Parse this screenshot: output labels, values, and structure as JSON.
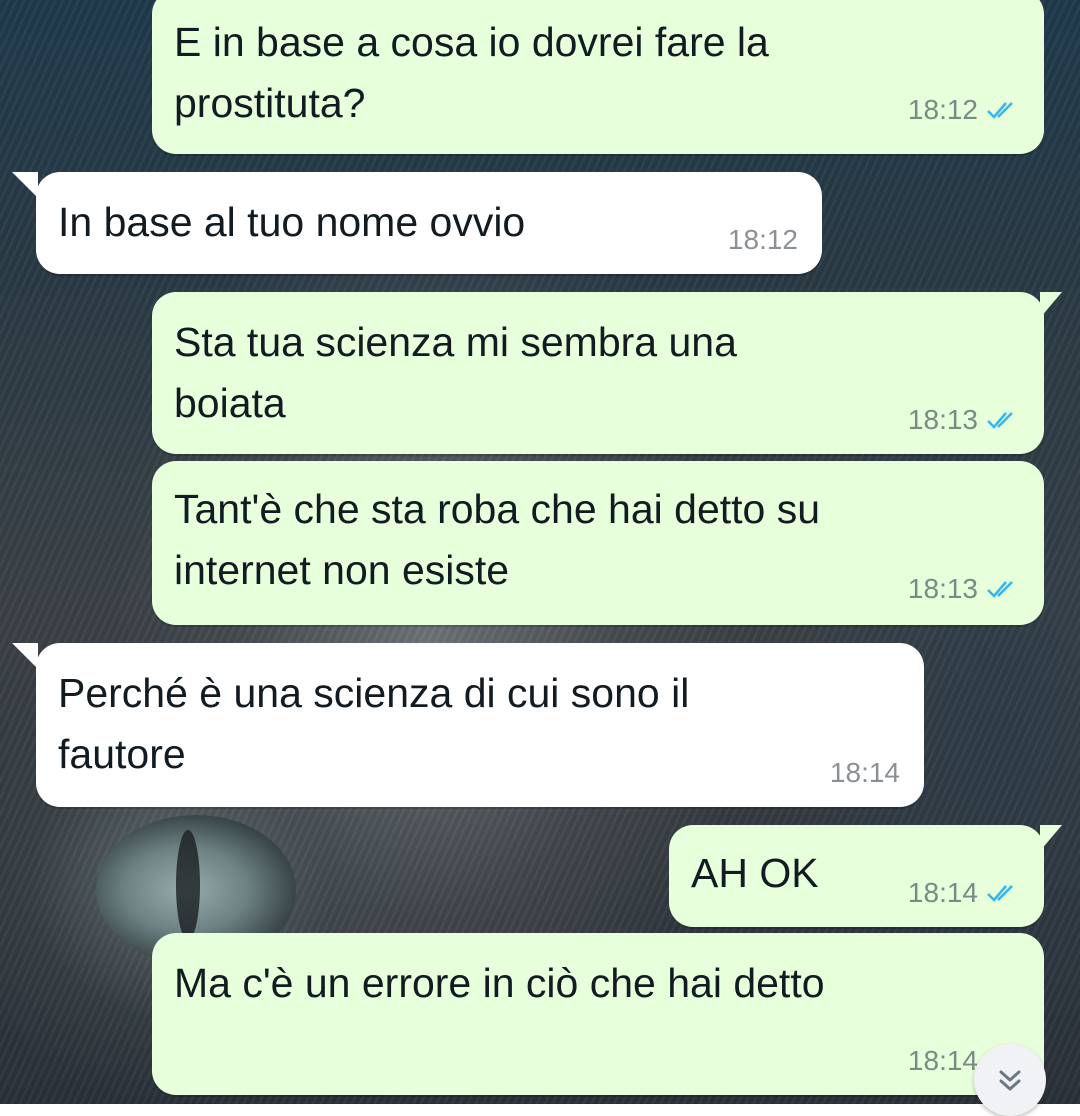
{
  "wallpaper": {
    "description_icon": "cat-wallpaper"
  },
  "messages": [
    {
      "direction": "out",
      "lines": [
        "E in base a cosa io dovrei fare la",
        "prostituta?"
      ],
      "time": "18:12",
      "status": "read"
    },
    {
      "direction": "in",
      "lines": [
        "In base al tuo nome ovvio"
      ],
      "time": "18:12"
    },
    {
      "direction": "out",
      "lines": [
        "Sta tua scienza mi sembra una",
        "boiata"
      ],
      "time": "18:13",
      "status": "read"
    },
    {
      "direction": "out",
      "lines": [
        "Tant'è che sta roba che hai detto su",
        "internet non esiste"
      ],
      "time": "18:13",
      "status": "read"
    },
    {
      "direction": "in",
      "lines": [
        "Perché è una scienza di cui sono il",
        "fautore"
      ],
      "time": "18:14"
    },
    {
      "direction": "out",
      "lines": [
        "AH OK"
      ],
      "time": "18:14",
      "status": "read"
    },
    {
      "direction": "out",
      "lines": [
        "Ma c'è un errore in ciò che hai detto"
      ],
      "time": "18:14",
      "status": "read"
    }
  ],
  "colors": {
    "outgoing_bubble": "#e7ffdb",
    "incoming_bubble": "#ffffff",
    "read_ticks": "#34b7f1"
  },
  "scroll_button": {
    "icon": "double-chevron-down-icon"
  }
}
